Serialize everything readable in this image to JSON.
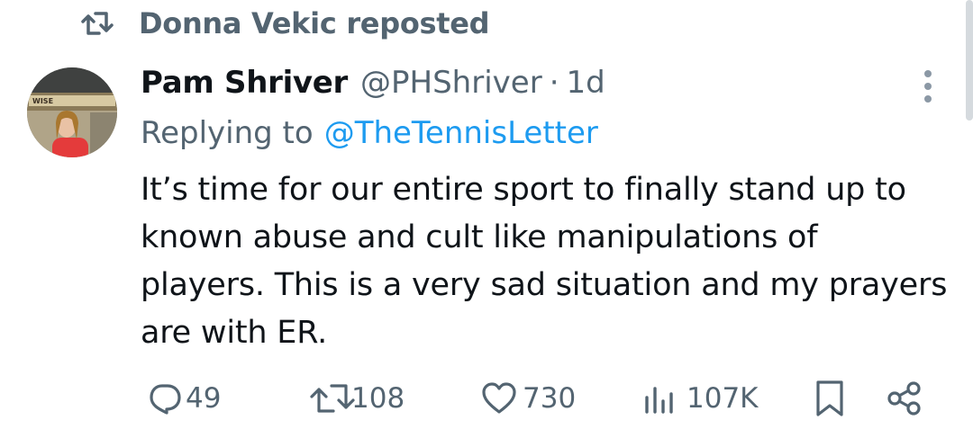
{
  "repost": {
    "text": "Donna Vekic reposted"
  },
  "tweet": {
    "author": {
      "display_name": "Pam Shriver",
      "handle": "@PHShriver",
      "separator": "·",
      "time": "1d"
    },
    "reply": {
      "prefix": "Replying to",
      "target": "@TheTennisLetter"
    },
    "body": "It’s time for our entire sport to finally stand up to known abuse and cult like manipulations of players. This is a very sad situation and my prayers are with ER.",
    "avatar_sign_text": "WISE"
  },
  "actions": {
    "replies": "49",
    "reposts": "108",
    "likes": "730",
    "views": "107K"
  },
  "colors": {
    "secondary": "#536471",
    "link": "#1d9bf0",
    "text": "#0f1419"
  }
}
